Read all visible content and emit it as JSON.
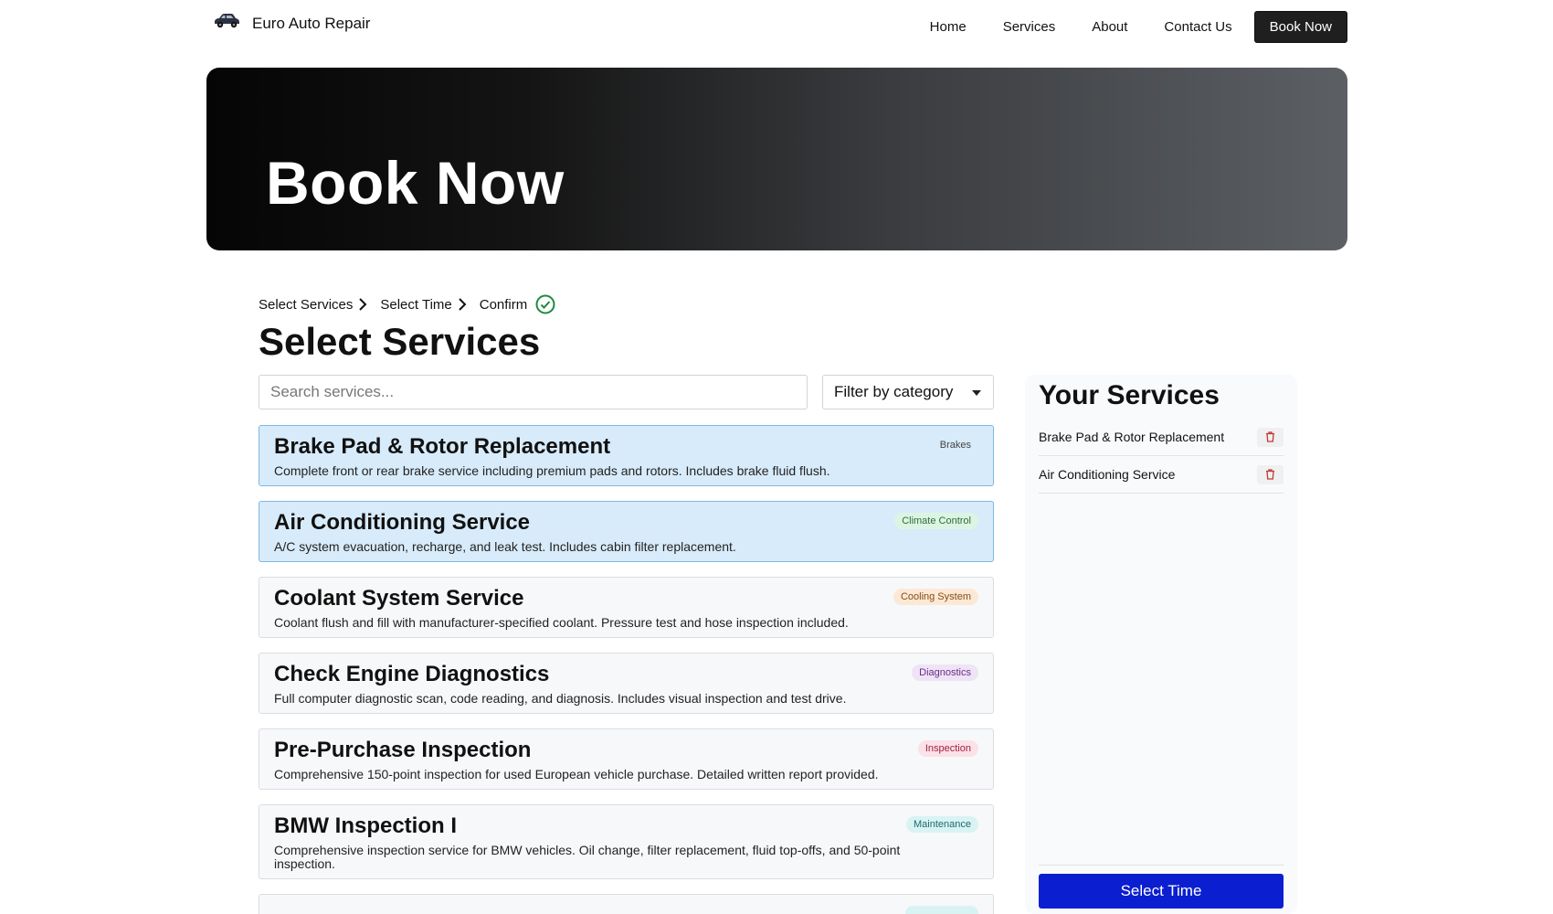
{
  "nav": {
    "brand": "Euro Auto Repair",
    "links": [
      "Home",
      "Services",
      "About",
      "Contact Us"
    ],
    "cta": "Book Now"
  },
  "hero": {
    "title": "Book Now"
  },
  "steps": [
    "Select Services",
    "Select Time",
    "Confirm"
  ],
  "page_title": "Select Services",
  "search": {
    "placeholder": "Search services...",
    "value": ""
  },
  "filter": {
    "label": "Filter by category"
  },
  "services": [
    {
      "name": "Brake Pad & Rotor Replacement",
      "desc": "Complete front or rear brake service including premium pads and rotors. Includes brake fluid flush.",
      "badge": "Brakes",
      "badge_bg": "#d8ebfa",
      "badge_fg": "#444444",
      "selected": true
    },
    {
      "name": "Air Conditioning Service",
      "desc": "A/C system evacuation, recharge, and leak test. Includes cabin filter replacement.",
      "badge": "Climate Control",
      "badge_bg": "#dcf5e3",
      "badge_fg": "#2f6b3d",
      "selected": true
    },
    {
      "name": "Coolant System Service",
      "desc": "Coolant flush and fill with manufacturer-specified coolant. Pressure test and hose inspection included.",
      "badge": "Cooling System",
      "badge_bg": "#fbe9d6",
      "badge_fg": "#8a4b12",
      "selected": false
    },
    {
      "name": "Check Engine Diagnostics",
      "desc": "Full computer diagnostic scan, code reading, and diagnosis. Includes visual inspection and test drive.",
      "badge": "Diagnostics",
      "badge_bg": "#efe3f6",
      "badge_fg": "#6a2d85",
      "selected": false
    },
    {
      "name": "Pre-Purchase Inspection",
      "desc": "Comprehensive 150-point inspection for used European vehicle purchase. Detailed written report provided.",
      "badge": "Inspection",
      "badge_bg": "#fbe1e8",
      "badge_fg": "#a3203f",
      "selected": false
    },
    {
      "name": "BMW Inspection I",
      "desc": "Comprehensive inspection service for BMW vehicles. Oil change, filter replacement, fluid top-offs, and 50-point inspection.",
      "badge": "Maintenance",
      "badge_bg": "#d9f3f3",
      "badge_fg": "#1d6b6e",
      "selected": false
    },
    {
      "name": "",
      "desc": "",
      "badge": "",
      "badge_bg": "#d9f3f3",
      "badge_fg": "#1d6b6e",
      "selected": false
    }
  ],
  "sidebar": {
    "title": "Your Services",
    "items": [
      "Brake Pad & Rotor Replacement",
      "Air Conditioning Service"
    ],
    "button": "Select Time"
  },
  "colors": {
    "primary_button": "#0b1ed0",
    "selected_bg": "#d8ebfa",
    "selected_border": "#7db8e6",
    "check_green": "#1e8a3c",
    "trash_red": "#c0392b"
  }
}
